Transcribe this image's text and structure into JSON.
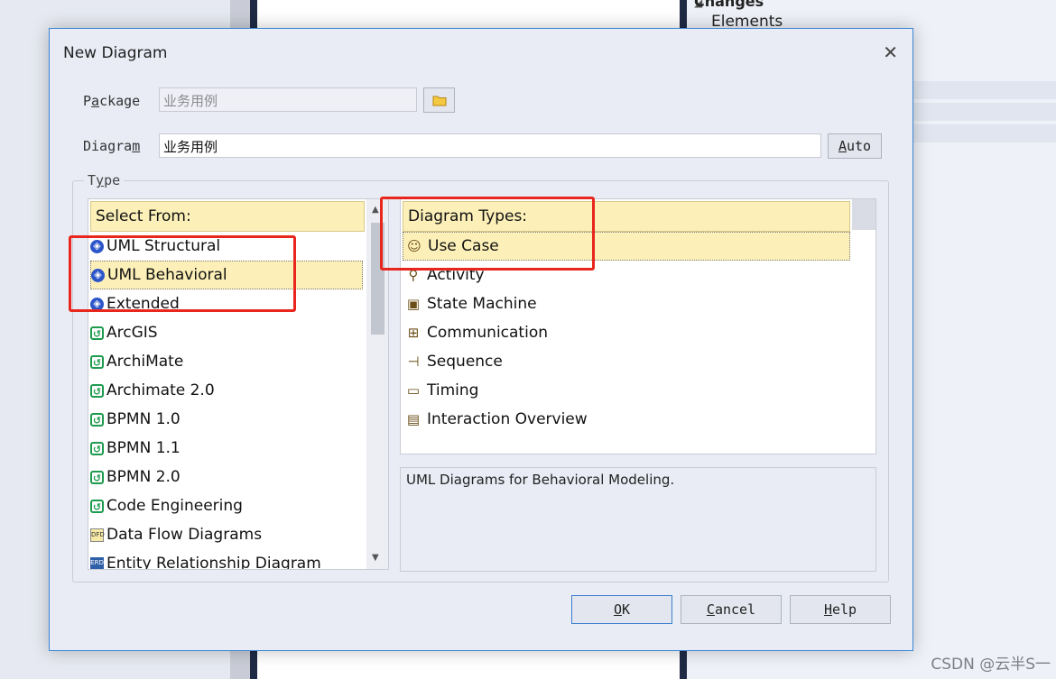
{
  "background": {
    "tree_header": "Changes",
    "tree_item": "Elements",
    "watermark": "CSDN @云半S一"
  },
  "dialog": {
    "title": "New Diagram",
    "package_label": "Package",
    "package_value": "业务用例",
    "diagram_label": "Diagram",
    "diagram_value": "业务用例",
    "auto_label": "Auto",
    "type_label": "Type",
    "select_from": {
      "header": "Select From:",
      "items": [
        {
          "label": "UML Structural",
          "icon": "uml-icon"
        },
        {
          "label": "UML Behavioral",
          "icon": "uml-icon",
          "selected": true
        },
        {
          "label": "Extended",
          "icon": "uml-icon"
        },
        {
          "label": "ArcGIS",
          "icon": "technology-icon"
        },
        {
          "label": "ArchiMate",
          "icon": "technology-icon"
        },
        {
          "label": "Archimate 2.0",
          "icon": "technology-icon"
        },
        {
          "label": "BPMN 1.0",
          "icon": "technology-icon"
        },
        {
          "label": "BPMN 1.1",
          "icon": "technology-icon"
        },
        {
          "label": "BPMN 2.0",
          "icon": "technology-icon"
        },
        {
          "label": "Code Engineering",
          "icon": "technology-icon"
        },
        {
          "label": "Data Flow Diagrams",
          "icon": "dfd-icon"
        },
        {
          "label": "Entity Relationship Diagram",
          "icon": "erd-icon"
        }
      ]
    },
    "diagram_types": {
      "header": "Diagram Types:",
      "items": [
        {
          "label": "Use Case",
          "icon": "use-case-icon",
          "selected": true
        },
        {
          "label": "Activity",
          "icon": "activity-icon"
        },
        {
          "label": "State Machine",
          "icon": "state-machine-icon"
        },
        {
          "label": "Communication",
          "icon": "communication-icon"
        },
        {
          "label": "Sequence",
          "icon": "sequence-icon"
        },
        {
          "label": "Timing",
          "icon": "timing-icon"
        },
        {
          "label": "Interaction Overview",
          "icon": "interaction-overview-icon"
        }
      ]
    },
    "description": "UML Diagrams for Behavioral Modeling.",
    "buttons": {
      "ok": "OK",
      "cancel": "Cancel",
      "help": "Help"
    },
    "colors": {
      "highlight": "#fcf0b8",
      "annotation": "#e8261d",
      "accent": "#3a86d6"
    }
  }
}
